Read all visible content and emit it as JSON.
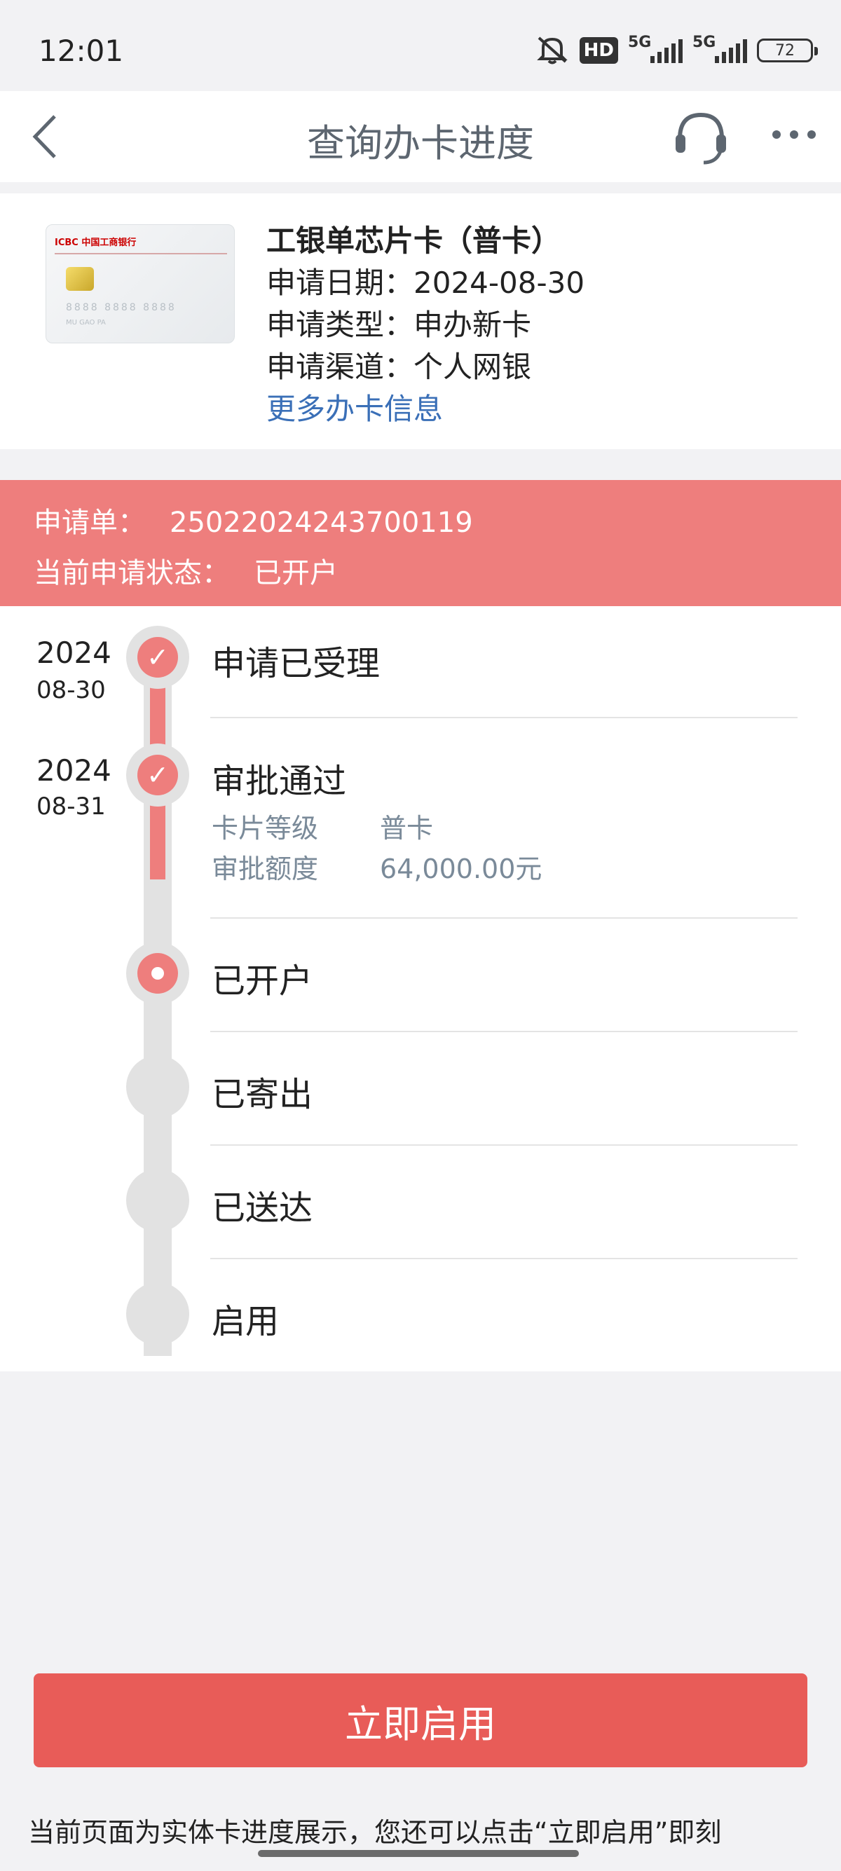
{
  "status_bar": {
    "time": "12:01",
    "hd_badge": "HD",
    "signal1": "5G",
    "signal2": "5G",
    "battery": "72"
  },
  "nav": {
    "title": "查询办卡进度",
    "back_icon": "chevron-left-icon",
    "service_icon": "headset-icon",
    "more_icon": "more-dots-icon"
  },
  "card": {
    "title": "工银单芯片卡（普卡）",
    "date": "申请日期：2024-08-30",
    "type": "申请类型：申办新卡",
    "channel": "申请渠道：个人网银",
    "more_link": "更多办卡信息",
    "image_logo": "ICBC 中国工商银行"
  },
  "banner": {
    "order_label": "申请单：",
    "order_value": "25022024243700119",
    "status_label": "当前申请状态：",
    "status_value": "已开户",
    "color": "#ee7e7d"
  },
  "timeline": {
    "steps": [
      {
        "label": "申请已受理",
        "year": "2024",
        "date": "08-30",
        "state": "done"
      },
      {
        "label": "审批通过",
        "year": "2024",
        "date": "08-31",
        "state": "done",
        "details": [
          {
            "key": "卡片等级",
            "value": "普卡"
          },
          {
            "key": "审批额度",
            "value": "64,000.00元"
          }
        ]
      },
      {
        "label": "已开户",
        "state": "current"
      },
      {
        "label": "已寄出",
        "state": "pending"
      },
      {
        "label": "已送达",
        "state": "pending"
      },
      {
        "label": "启用",
        "state": "pending"
      }
    ]
  },
  "button": {
    "label": "立即启用",
    "color": "#e85c58"
  },
  "footer_note": "当前页面为实体卡进度展示，您还可以点击“立即启用”即刻"
}
